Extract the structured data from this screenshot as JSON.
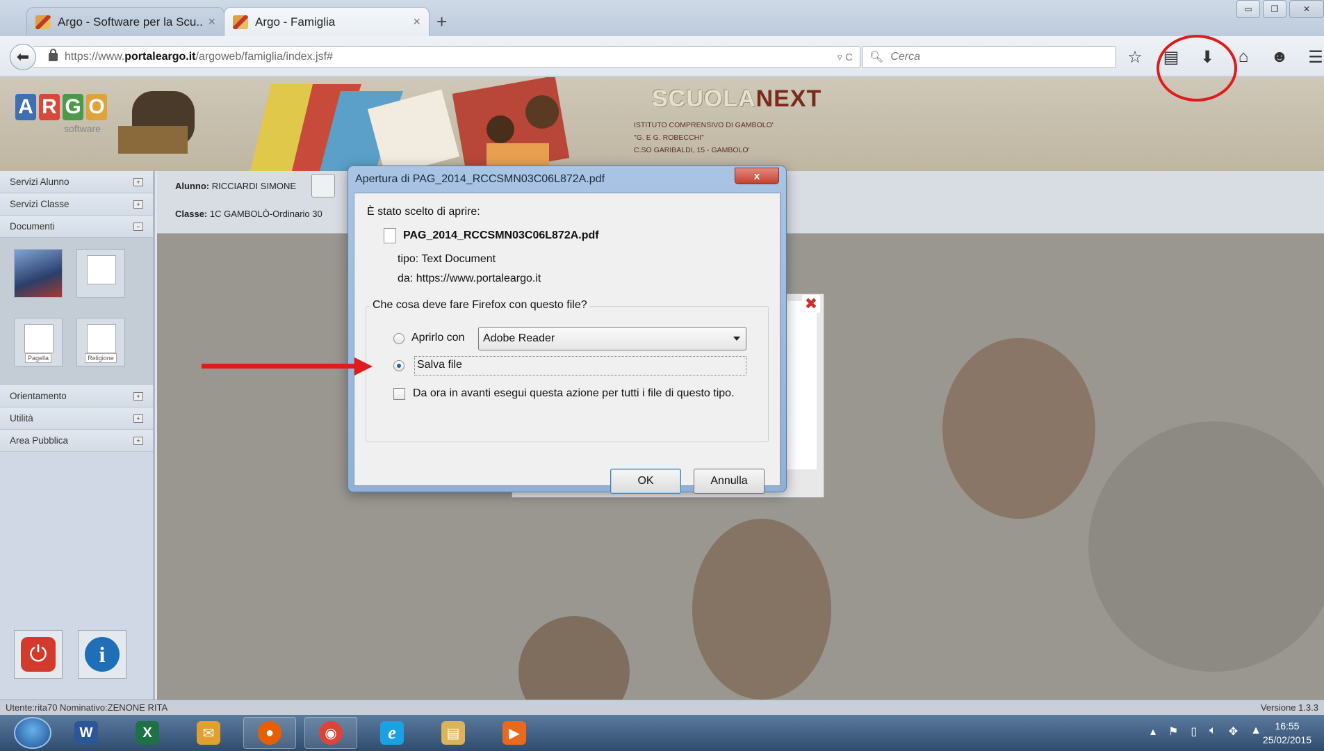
{
  "browser": {
    "tabs": [
      {
        "label": "Argo - Software per la Scu...",
        "close": "×"
      },
      {
        "label": "Argo - Famiglia",
        "close": "×"
      }
    ],
    "new_tab": "+",
    "url_prefix": "https://www.",
    "url_host": "portaleargo.it",
    "url_path": "/argoweb/famiglia/index.jsf#",
    "url_icons": "▿ C",
    "search_placeholder": "Cerca",
    "toolbar_icons": [
      "bookmark-star-icon",
      "reading-list-icon",
      "downloads-icon",
      "home-icon",
      "chat-icon",
      "menu-icon"
    ],
    "window_buttons": [
      "minimize",
      "restore",
      "close"
    ]
  },
  "header": {
    "logo_letters": [
      "A",
      "R",
      "G",
      "O"
    ],
    "logo_colors": [
      "#3e6fb0",
      "#d9473a",
      "#4a9a4a",
      "#e2a23a"
    ],
    "logo_sub": "software",
    "brand_part1": "SCUOLA",
    "brand_part2": "NEXT",
    "school_line1": "ISTITUTO COMPRENSIVO DI GAMBOLO'",
    "school_line2": "\"G. E G. ROBECCHI\"",
    "school_line3": "C.SO GARIBALDI, 15 - GAMBOLO'"
  },
  "sidebar": {
    "items_top": [
      {
        "label": "Servizi Alunno",
        "toggle": "+"
      },
      {
        "label": "Servizi Classe",
        "toggle": "+"
      },
      {
        "label": "Documenti",
        "toggle": "−"
      }
    ],
    "doc_icons": [
      {
        "label": ""
      },
      {
        "label": ""
      },
      {
        "label": "Pagella"
      },
      {
        "label": "Religione"
      }
    ],
    "items_bottom": [
      {
        "label": "Orientamento",
        "toggle": "+"
      },
      {
        "label": "Utilità",
        "toggle": "+"
      },
      {
        "label": "Area Pubblica",
        "toggle": "+"
      }
    ]
  },
  "student": {
    "alunno_label": "Alunno:",
    "alunno_value": "RICCIARDI SIMONE",
    "classe_label": "Classe:",
    "classe_value": "1C GAMBOLÒ-Ordinario 30"
  },
  "dialog": {
    "title": "Apertura di PAG_2014_RCCSMN03C06L872A.pdf",
    "close": "x",
    "chosen_text": "È stato scelto di aprire:",
    "filename": "PAG_2014_RCCSMN03C06L872A.pdf",
    "type_label": "tipo:",
    "type_value": "Text Document",
    "from_label": "da:",
    "from_value": "https://www.portaleargo.it",
    "question": "Che cosa deve fare Firefox con questo file?",
    "open_with_label": "Aprirlo con",
    "open_with_app": "Adobe Reader",
    "save_label": "Salva file",
    "save_selected": true,
    "remember_label": "Da ora in avanti esegui questa azione per tutti i file di questo tipo.",
    "ok": "OK",
    "cancel": "Annulla"
  },
  "status": {
    "user": "Utente:rita70 Nominativo:ZENONE RITA",
    "version": "Versione 1.3.3"
  },
  "taskbar": {
    "apps": [
      {
        "name": "word",
        "glyph": "W",
        "color": "#2b5797"
      },
      {
        "name": "excel",
        "glyph": "X",
        "color": "#1e7145"
      },
      {
        "name": "outlook",
        "glyph": "✉",
        "color": "#e0a030"
      },
      {
        "name": "firefox",
        "glyph": "●",
        "color": "#e66000"
      },
      {
        "name": "chrome",
        "glyph": "◉",
        "color": "#db4437"
      },
      {
        "name": "internet-explorer",
        "glyph": "e",
        "color": "#1ba1e2"
      },
      {
        "name": "file-explorer",
        "glyph": "▤",
        "color": "#d9b45a"
      },
      {
        "name": "media-player",
        "glyph": "▶",
        "color": "#e86a1f"
      }
    ],
    "time": "16:55",
    "date": "25/02/2015"
  }
}
